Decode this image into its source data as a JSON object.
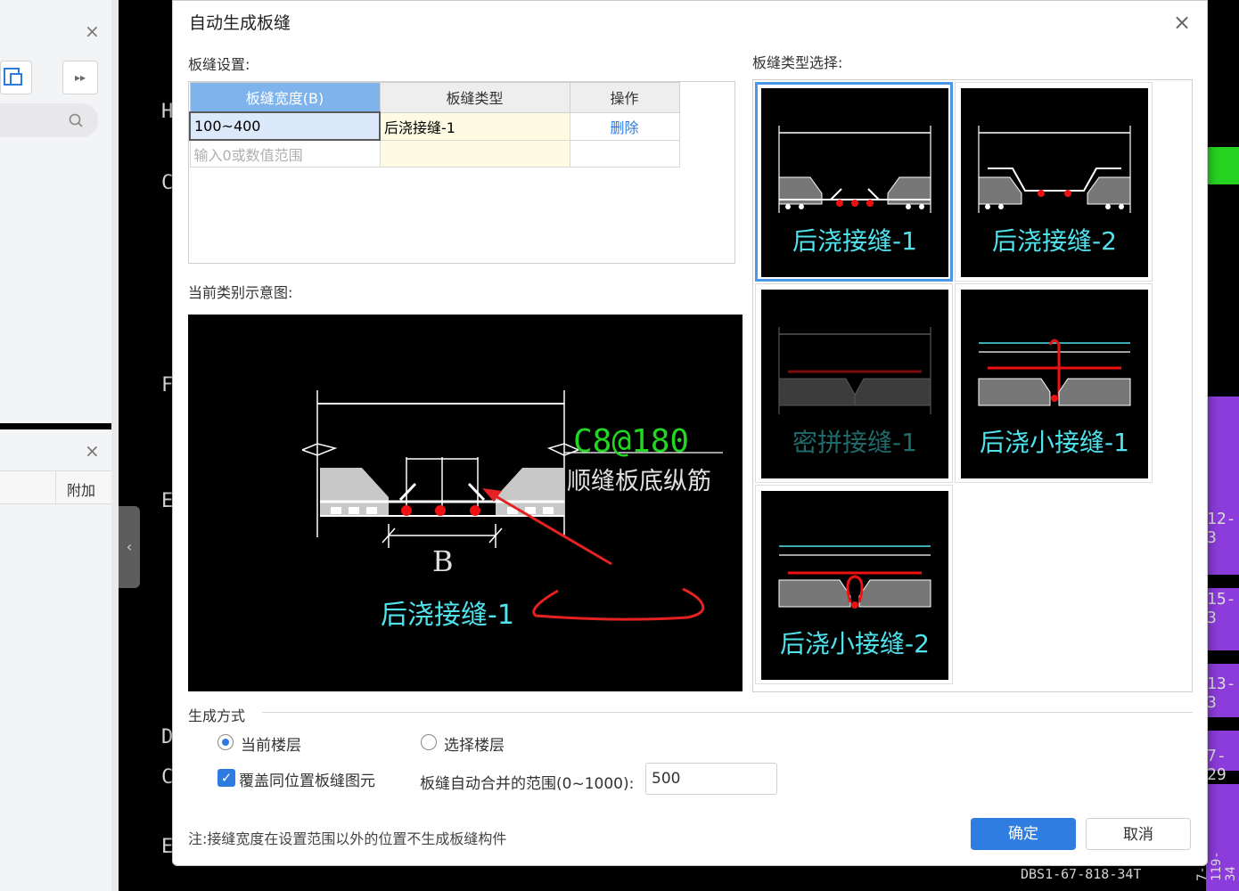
{
  "left_panel": {
    "close_symbol": "×",
    "expand_symbol": "▸▸",
    "addon_label": "附加"
  },
  "cad_letters": [
    "H",
    "C",
    "F",
    "E",
    "D",
    "C",
    "E"
  ],
  "dialog": {
    "title": "自动生成板缝",
    "close_symbol": "×",
    "settings_label": "板缝设置:",
    "table": {
      "headers": [
        "板缝宽度(B)",
        "板缝类型",
        "操作"
      ],
      "rows": [
        {
          "width": "100~400",
          "type": "后浇接缝-1",
          "action": "删除"
        }
      ],
      "new_row_placeholder": "输入0或数值范围"
    },
    "type_select_label": "板缝类型选择:",
    "types": [
      {
        "name": "后浇接缝-1",
        "selected": true,
        "enabled": true
      },
      {
        "name": "后浇接缝-2",
        "selected": false,
        "enabled": true
      },
      {
        "name": "密拼接缝-1",
        "selected": false,
        "enabled": false
      },
      {
        "name": "后浇小接缝-1",
        "selected": false,
        "enabled": true
      },
      {
        "name": "后浇小接缝-2",
        "selected": false,
        "enabled": true
      }
    ],
    "preview_label": "当前类别示意图:",
    "preview": {
      "rebar_spec": "C8@180",
      "rebar_desc": "顺缝板底纵筋",
      "dim_label": "B",
      "type_name": "后浇接缝-1"
    },
    "generation": {
      "section_label": "生成方式",
      "options": [
        {
          "label": "当前楼层",
          "checked": true
        },
        {
          "label": "选择楼层",
          "checked": false
        }
      ],
      "override_label": "覆盖同位置板缝图元",
      "override_checked": true,
      "merge_range_label": "板缝自动合并的范围(0~1000):",
      "merge_range_value": "500"
    },
    "note": "注:接缝宽度在设置范围以外的位置不生成板缝构件",
    "ok_label": "确定",
    "cancel_label": "取消"
  },
  "right_strip": {
    "labels": [
      "12-3",
      "15-3",
      "13-3",
      "7-29",
      "7-119-34"
    ],
    "bottom_text": "DBS1-67-818-34T"
  },
  "colors": {
    "accent": "#2f7de1",
    "header_active": "#7eb3ec",
    "type_label": "#4fe3ee",
    "rebar_text": "#22d622",
    "cad_purple": "#8c3cdb",
    "cad_green": "#27d321"
  }
}
